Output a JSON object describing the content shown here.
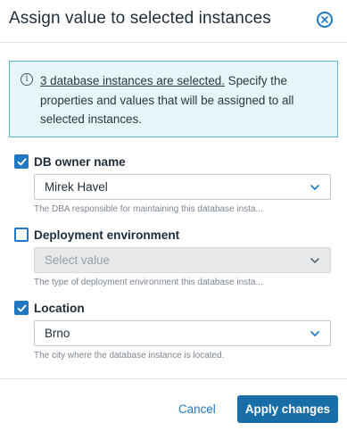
{
  "dialog": {
    "title": "Assign value to selected instances",
    "close_icon": "close-circle-icon"
  },
  "info": {
    "icon": "info-icon",
    "icon_glyph": "i",
    "link_text": "3 database instances are selected.",
    "text": " Specify the properties and values that will be assigned to all selected instances."
  },
  "fields": [
    {
      "label": "DB owner name",
      "checked": true,
      "value": "Mirek Havel",
      "disabled": false,
      "help": "The DBA responsible for maintaining this database insta..."
    },
    {
      "label": "Deployment environment",
      "checked": false,
      "value": "Select value",
      "disabled": true,
      "help": "The type of deployment environment this database insta..."
    },
    {
      "label": "Location",
      "checked": true,
      "value": "Brno",
      "disabled": false,
      "help": "The city where the database instance is located."
    }
  ],
  "footer": {
    "cancel_label": "Cancel",
    "apply_label": "Apply changes"
  },
  "colors": {
    "accent": "#1f78c1",
    "primary_button": "#1a6ea8",
    "info_background": "#e8f5f8",
    "info_border": "#5fb8cc"
  }
}
